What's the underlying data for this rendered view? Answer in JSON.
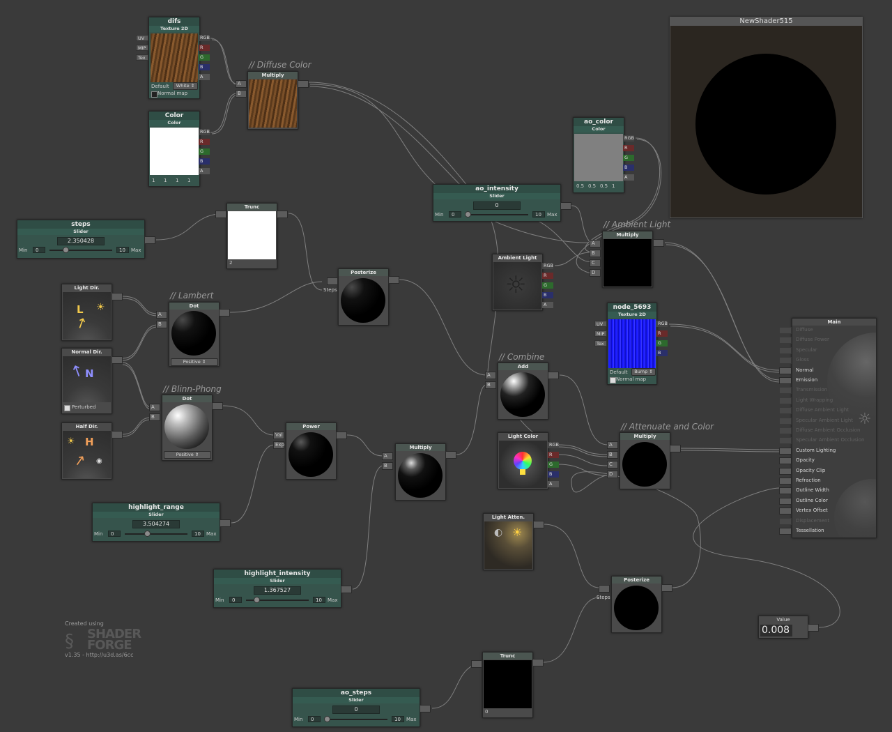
{
  "preview_window": {
    "title": "NewShader515"
  },
  "comments": {
    "diffuse": "// Diffuse Color",
    "ambient": "// Ambient Light",
    "lambert": "// Lambert",
    "blinn": "// Blinn-Phong",
    "combine": "// Combine",
    "attenuate": "// Attenuate and Color"
  },
  "difs": {
    "name": "difs",
    "type": "Texture 2D",
    "inputs": [
      "UV",
      "MIP",
      "Tex"
    ],
    "outputs": [
      "RGB",
      "R",
      "G",
      "B",
      "A"
    ],
    "default_label": "Default",
    "default_value": "White",
    "normal_map_label": "Normal map",
    "normal_map_checked": false
  },
  "diffuse_mult": {
    "title": "Multiply",
    "inputs": [
      "A",
      "B"
    ]
  },
  "color": {
    "name": "Color",
    "type": "Color",
    "outputs": [
      "RGB",
      "R",
      "G",
      "B",
      "A"
    ],
    "values": [
      "1",
      "1",
      "1",
      "1"
    ]
  },
  "ao_color": {
    "name": "ao_color",
    "type": "Color",
    "outputs": [
      "RGB",
      "R",
      "G",
      "B",
      "A"
    ],
    "values": [
      "0.5",
      "0.5",
      "0.5",
      "1"
    ]
  },
  "ao_intensity": {
    "name": "ao_intensity",
    "type": "Slider",
    "value": "0",
    "min_label": "Min",
    "min": "0",
    "max": "10",
    "max_label": "Max"
  },
  "steps": {
    "name": "steps",
    "type": "Slider",
    "value": "2.350428",
    "min_label": "Min",
    "min": "0",
    "max": "10",
    "max_label": "Max"
  },
  "trunc1": {
    "title": "Trunc",
    "value": "2"
  },
  "posterize1": {
    "title": "Posterize",
    "input": "Steps"
  },
  "ambient_mult": {
    "title": "Multiply",
    "inputs": [
      "A",
      "B",
      "C",
      "D"
    ]
  },
  "ambient_light": {
    "title": "Ambient Light",
    "outputs": [
      "RGB",
      "R",
      "G",
      "B",
      "A"
    ]
  },
  "light_dir": {
    "title": "Light Dir.",
    "glyph": "L"
  },
  "lambert_dot": {
    "title": "Dot",
    "inputs": [
      "A",
      "B"
    ],
    "mode": "Positive"
  },
  "normal_dir": {
    "title": "Normal Dir.",
    "glyph": "N",
    "perturbed_label": "Perturbed",
    "perturbed_checked": true
  },
  "blinn_dot": {
    "title": "Dot",
    "inputs": [
      "A",
      "B"
    ],
    "mode": "Positive"
  },
  "half_dir": {
    "title": "Half Dir.",
    "glyph": "H"
  },
  "power": {
    "title": "Power",
    "inputs": [
      "Val",
      "Exp"
    ]
  },
  "spec_mult": {
    "title": "Multiply",
    "inputs": [
      "A",
      "B"
    ]
  },
  "add": {
    "title": "Add",
    "inputs": [
      "A",
      "B"
    ]
  },
  "node_5693": {
    "name": "node_5693",
    "type": "Texture 2D",
    "inputs": [
      "UV",
      "MIP",
      "Tex"
    ],
    "outputs": [
      "RGB",
      "R",
      "G",
      "B",
      "A"
    ],
    "default_label": "Default",
    "default_value": "Bump",
    "normal_map_label": "Normal map",
    "normal_map_checked": true
  },
  "light_color": {
    "title": "Light Color",
    "outputs": [
      "RGB",
      "R",
      "G",
      "B",
      "A"
    ]
  },
  "atten_mult": {
    "title": "Multiply",
    "inputs": [
      "A",
      "B",
      "C",
      "D"
    ]
  },
  "light_atten": {
    "title": "Light Atten."
  },
  "highlight_range": {
    "name": "highlight_range",
    "type": "Slider",
    "value": "3.504274",
    "min_label": "Min",
    "min": "0",
    "max": "10",
    "max_label": "Max"
  },
  "highlight_intensity": {
    "name": "highlight_intensity",
    "type": "Slider",
    "value": "1.367527",
    "min_label": "Min",
    "min": "0",
    "max": "10",
    "max_label": "Max"
  },
  "posterize2": {
    "title": "Posterize",
    "input": "Steps"
  },
  "trunc2": {
    "title": "Trunc",
    "value": "0"
  },
  "ao_steps": {
    "name": "ao_steps",
    "type": "Slider",
    "value": "0",
    "min_label": "Min",
    "min": "0",
    "max": "10",
    "max_label": "Max"
  },
  "value_node": {
    "title": "Value",
    "value": "0.008"
  },
  "main": {
    "title": "Main",
    "inputs": [
      {
        "label": "Diffuse",
        "active": false
      },
      {
        "label": "Diffuse Power",
        "active": false
      },
      {
        "label": "Specular",
        "active": false
      },
      {
        "label": "Gloss",
        "active": false
      },
      {
        "label": "Normal",
        "active": true
      },
      {
        "label": "Emission",
        "active": true
      },
      {
        "label": "Transmission",
        "active": false
      },
      {
        "label": "Light Wrapping",
        "active": false
      },
      {
        "label": "Diffuse Ambient Light",
        "active": false
      },
      {
        "label": "Specular Ambient Light",
        "active": false
      },
      {
        "label": "Diffuse Ambient Occlusion",
        "active": false
      },
      {
        "label": "Specular Ambient Occlusion",
        "active": false
      },
      {
        "label": "Custom Lighting",
        "active": true
      },
      {
        "label": "Opacity",
        "active": true
      },
      {
        "label": "Opacity Clip",
        "active": true
      },
      {
        "label": "Refraction",
        "active": true
      },
      {
        "label": "Outline Width",
        "active": true
      },
      {
        "label": "Outline Color",
        "active": true
      },
      {
        "label": "Vertex Offset",
        "active": true
      },
      {
        "label": "Displacement",
        "active": false
      },
      {
        "label": "Tessellation",
        "active": true
      }
    ]
  },
  "branding": {
    "created_using": "Created using",
    "logo_top": "SHADER",
    "logo_bottom": "FORGE",
    "version": "v1.35 - http://u3d.as/6cc"
  },
  "colors": {
    "background": "#3a3a3a",
    "node_header": "#4b5651",
    "param_node": "#36544c",
    "wire": "#8a8a8a"
  }
}
